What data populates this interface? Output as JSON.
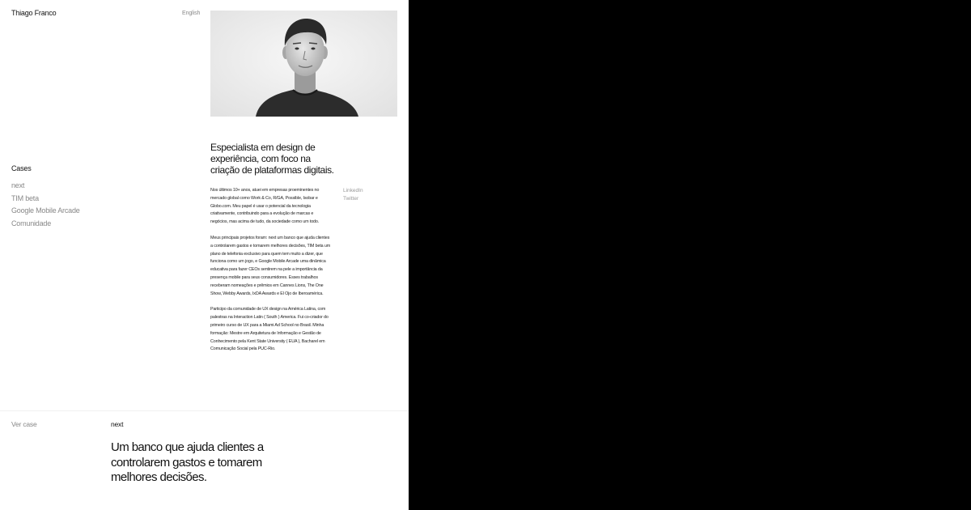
{
  "header": {
    "site_name": "Thiago Franco",
    "language_link": "English"
  },
  "profile": {
    "photo_alt": "portrait-photo"
  },
  "nav": {
    "heading": "Cases",
    "items": [
      {
        "label": "next"
      },
      {
        "label": "TIM beta"
      },
      {
        "label": "Google Mobile Arcade"
      },
      {
        "label": "Comunidade"
      }
    ]
  },
  "intro": {
    "headline": "Especialista em design de experiência, com foco na criação de plataformas digitais.",
    "paragraphs": [
      "Nos últimos 10+ anos, atuei em empresas proeminentes no mercado global como Work & Co, R/GA, Possible, Isobar e Globo.com. Meu papel é usar o potencial da tecnologia criativamente, contribuindo para a evolução de marcas e negócios, mas acima de tudo, da sociedade como um todo.",
      "Meus principais projetos foram: next um banco que ajuda clientes a controlarem gastos e tomarem melhores decisões, TIM beta um plano de telefonia exclusivo para quem tem muito a dizer, que funciona como um jogo, e Google Mobile Arcade uma dinâmica educativa para fazer CEOs sentirem na pele a importância da presença mobile para seus consumidores. Esses trabalhos receberam nomeações e prêmios em Cannes Lions, The One Show, Webby Awards, IxDA Awards e El Ojo de Iberoamérica.",
      "Participo da comunidade de UX design na América Latina, com palestras na Interaction Latin ( South ) America. Fui co-criador do primeiro curso de UX para a Miami Ad School no Brasil. Minha formação: Mestre em Arquitetura de Informação e Gestão de Conhecimento pela Kent State University ( EUA ), Bacharel em Comunicação Social pela PUC-Rio."
    ]
  },
  "social": {
    "links": [
      {
        "label": "LinkedIn"
      },
      {
        "label": "Twitter"
      }
    ]
  },
  "case_preview": {
    "link_label": "Ver case",
    "name": "next",
    "title": "Um banco que ajuda clientes a controlarem gastos e tomarem melhores decisões."
  },
  "colors": {
    "page_bg": "#ffffff",
    "outer_bg": "#000000",
    "text": "#111111",
    "muted": "#888888"
  }
}
